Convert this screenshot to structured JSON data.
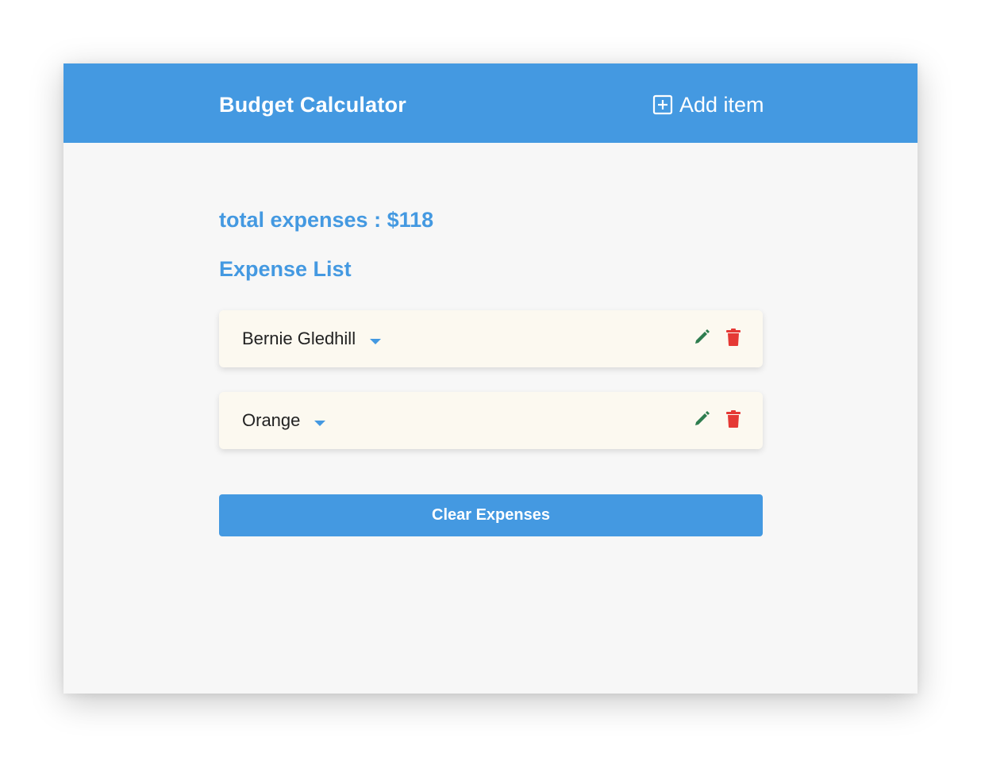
{
  "navbar": {
    "brand": "Budget Calculator",
    "add_item_label": "Add item",
    "add_item_icon": "plus-square-icon"
  },
  "summary": {
    "total_label": "total expenses : $118"
  },
  "list": {
    "title": "Expense List",
    "items": [
      {
        "name": "Bernie Gledhill"
      },
      {
        "name": "Orange"
      }
    ]
  },
  "actions": {
    "clear_label": "Clear Expenses"
  },
  "colors": {
    "primary": "#4499e1",
    "edit": "#2e7d4f",
    "delete": "#e53935",
    "item_bg": "#fcf9f0",
    "page_bg": "#f7f7f7"
  }
}
